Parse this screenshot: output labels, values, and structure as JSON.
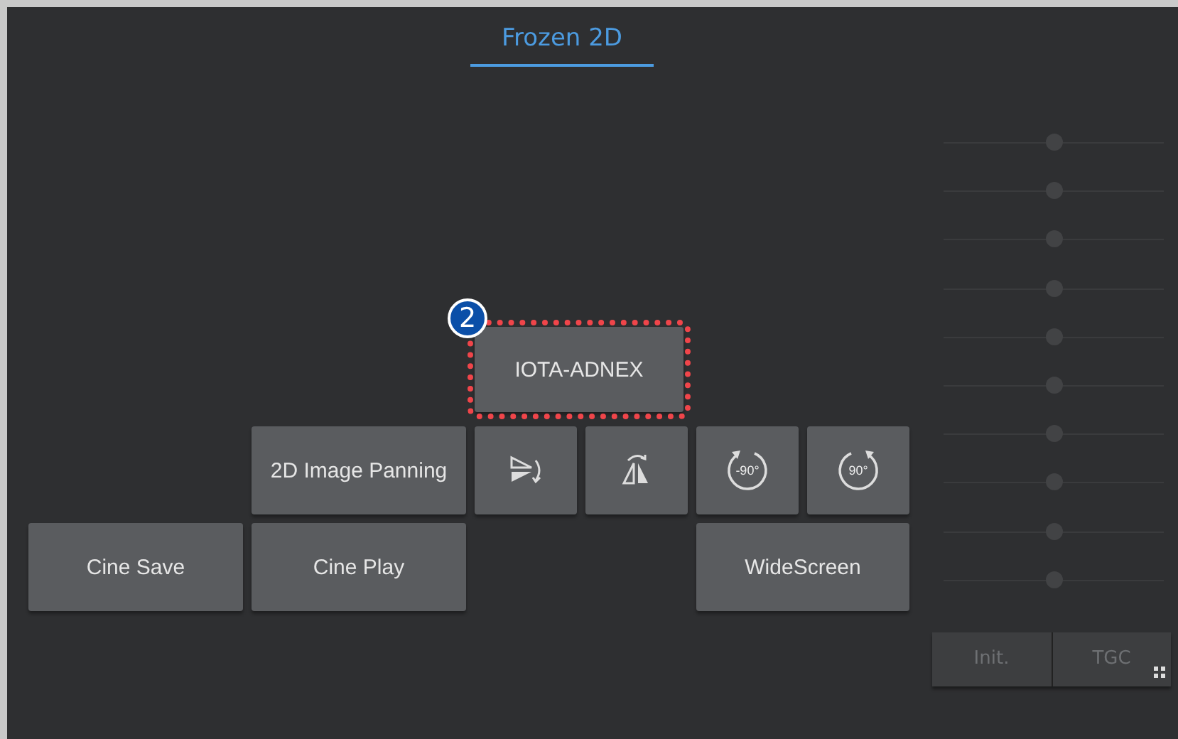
{
  "header": {
    "title": "Frozen 2D",
    "selected": true
  },
  "buttons": [
    {
      "kind": "text",
      "label": "IOTA-ADNEX",
      "highlighted": true,
      "callout": "2"
    },
    {
      "kind": "text",
      "label": "2D Image Panning",
      "highlighted": false
    },
    {
      "kind": "flipv",
      "highlighted": false
    },
    {
      "kind": "fliph",
      "highlighted": false
    },
    {
      "kind": "rotleft",
      "label": "-90°",
      "highlighted": false
    },
    {
      "kind": "rotright",
      "label": "90°",
      "highlighted": false
    },
    {
      "kind": "text",
      "label": "Cine Save",
      "highlighted": false
    },
    {
      "kind": "text",
      "label": "Cine Play",
      "highlighted": false
    },
    {
      "kind": "text",
      "label": "WideScreen",
      "highlighted": false
    }
  ],
  "tgc_sliders": [
    {
      "level": 0.5
    },
    {
      "level": 0.5
    },
    {
      "level": 0.5
    },
    {
      "level": 0.5
    },
    {
      "level": 0.5
    },
    {
      "level": 0.5
    },
    {
      "level": 0.5
    },
    {
      "level": 0.5
    },
    {
      "level": 0.5
    },
    {
      "level": 0.5
    }
  ],
  "tgc_buttons": [
    {
      "label": "Init.",
      "disabled": true
    },
    {
      "label": "TGC",
      "disabled": true,
      "menu": true
    }
  ]
}
